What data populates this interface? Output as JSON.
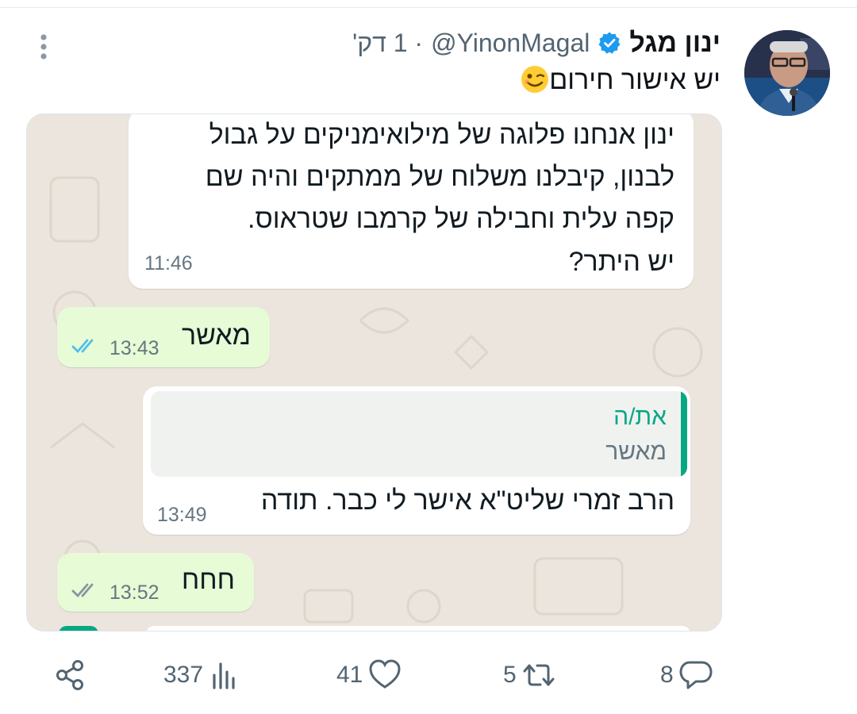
{
  "tweet": {
    "author_name": "ינון מגל",
    "handle": "@YinonMagal",
    "time": "· 1 דק'",
    "text": "יש אישור חירום",
    "emoji": "winking-face"
  },
  "chat": {
    "msg1": {
      "lines": [
        "ינון אנחנו פלוגה של מילואימניקים על גבול",
        "לבנון, קיבלנו משלוח של ממתקים והיה שם",
        "קפה עלית וחבילה של קרמבו שטראוס.",
        "יש היתר?"
      ],
      "time": "11:46"
    },
    "msg2": {
      "text": "מאשר",
      "time": "13:43"
    },
    "msg3": {
      "quote_name": "את/ה",
      "quote_text": "מאשר",
      "text": "הרב זמרי שליט\"א אישר לי כבר. תודה",
      "time": "13:49"
    },
    "msg4": {
      "text": "חחח",
      "time": "13:52"
    }
  },
  "actions": {
    "replies": "8",
    "retweets": "5",
    "likes": "41",
    "views": "337"
  },
  "colors": {
    "verified": "#1d9bf0",
    "chat_bg": "#ece5dd",
    "outgoing_bubble": "#e6fbd6",
    "incoming_bubble": "#ffffff",
    "quote_accent": "#06a884",
    "read_ticks": "#53bdeb",
    "icon_gray": "#536471"
  }
}
